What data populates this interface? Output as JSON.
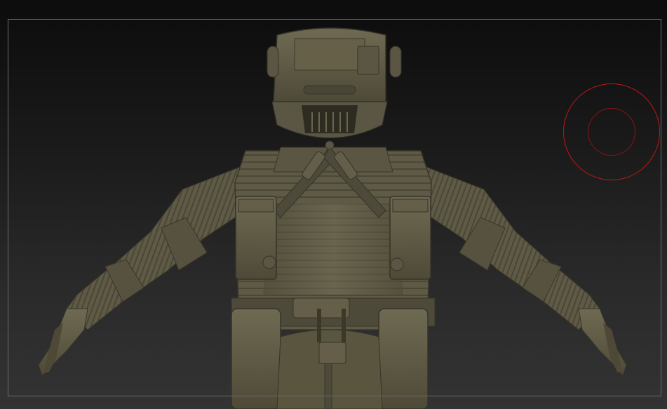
{
  "app": {
    "name": "",
    "scene": {
      "background_top": "#0c0c0c",
      "background_bottom": "#333333",
      "material_color": "#5e5a45",
      "frame_color": "#6a6a6a",
      "brush_color": "#c01818"
    },
    "elements": {
      "model": "sculpt-model",
      "brush": "brush-cursor"
    }
  }
}
